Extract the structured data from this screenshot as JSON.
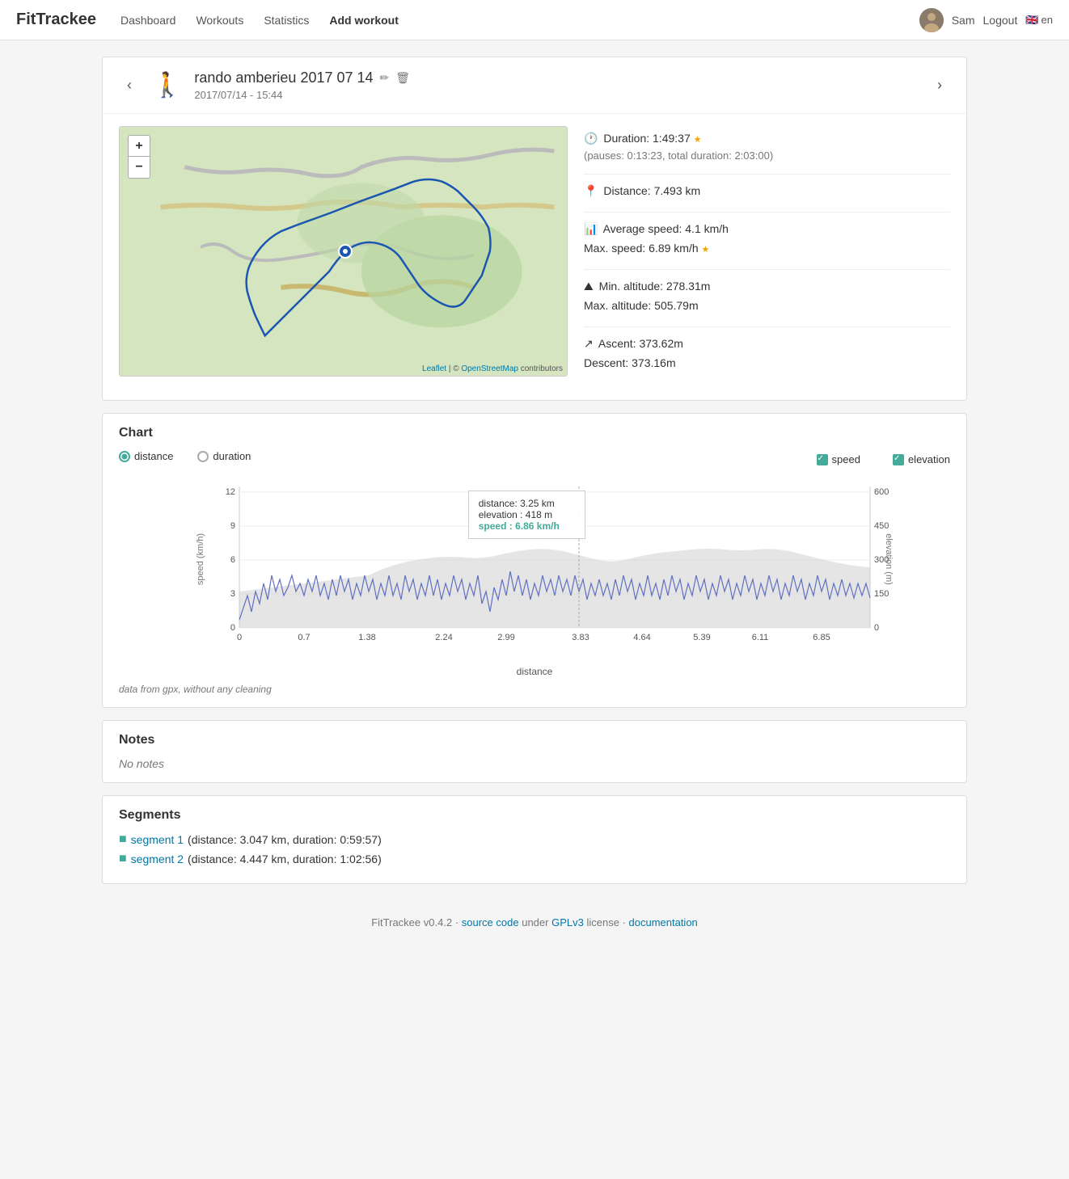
{
  "navbar": {
    "brand": "FitTrackee",
    "links": [
      {
        "label": "Dashboard",
        "href": "#"
      },
      {
        "label": "Workouts",
        "href": "#"
      },
      {
        "label": "Statistics",
        "href": "#"
      },
      {
        "label": "Add workout",
        "href": "#",
        "bold": true
      }
    ],
    "user": "Sam",
    "logout": "Logout",
    "lang": "en"
  },
  "workout": {
    "title": "rando amberieu 2017 07 14",
    "date": "2017/07/14 - 15:44",
    "stats": {
      "duration_label": "Duration: 1:49:37",
      "duration_note": "(pauses: 0:13:23, total duration: 2:03:00)",
      "distance_label": "Distance: 7.493 km",
      "avg_speed_label": "Average speed: 4.1 km/h",
      "max_speed_label": "Max. speed: 6.89 km/h",
      "min_alt_label": "Min. altitude: 278.31m",
      "max_alt_label": "Max. altitude: 505.79m",
      "ascent_label": "Ascent: 373.62m",
      "descent_label": "Descent: 373.16m"
    }
  },
  "chart": {
    "title": "Chart",
    "x_label": "distance",
    "x_ticks": [
      "0",
      "0.7",
      "1.38",
      "2.24",
      "2.99",
      "3.83",
      "4.64",
      "5.39",
      "6.11",
      "6.85"
    ],
    "y_left_label": "speed (km/h)",
    "y_left_ticks": [
      "0",
      "3",
      "6",
      "9",
      "12"
    ],
    "y_right_label": "elevation (m)",
    "y_right_ticks": [
      "0",
      "150",
      "300",
      "450",
      "600"
    ],
    "distance_radio_label": "distance",
    "duration_radio_label": "duration",
    "speed_checkbox_label": "speed",
    "elevation_checkbox_label": "elevation",
    "tooltip": {
      "distance": "distance: 3.25 km",
      "elevation": "elevation : 418 m",
      "speed": "speed : 6.86 km/h"
    },
    "note": "data from gpx, without any cleaning"
  },
  "notes": {
    "title": "Notes",
    "content": "No notes"
  },
  "segments": {
    "title": "Segments",
    "items": [
      {
        "label": "segment 1",
        "detail": " (distance: 3.047 km, duration: 0:59:57)"
      },
      {
        "label": "segment 2",
        "detail": " (distance: 4.447 km, duration: 1:02:56)"
      }
    ]
  },
  "footer": {
    "brand": "FitTrackee",
    "version": "v0.4.2",
    "source_code_label": "source code",
    "under_label": "under",
    "license_label": "GPLv3",
    "license_suffix": "license ·",
    "documentation_label": "documentation"
  },
  "map": {
    "attribution_leaflet": "Leaflet",
    "attribution_osm": "OpenStreetMap",
    "attribution_contributors": " contributors"
  }
}
